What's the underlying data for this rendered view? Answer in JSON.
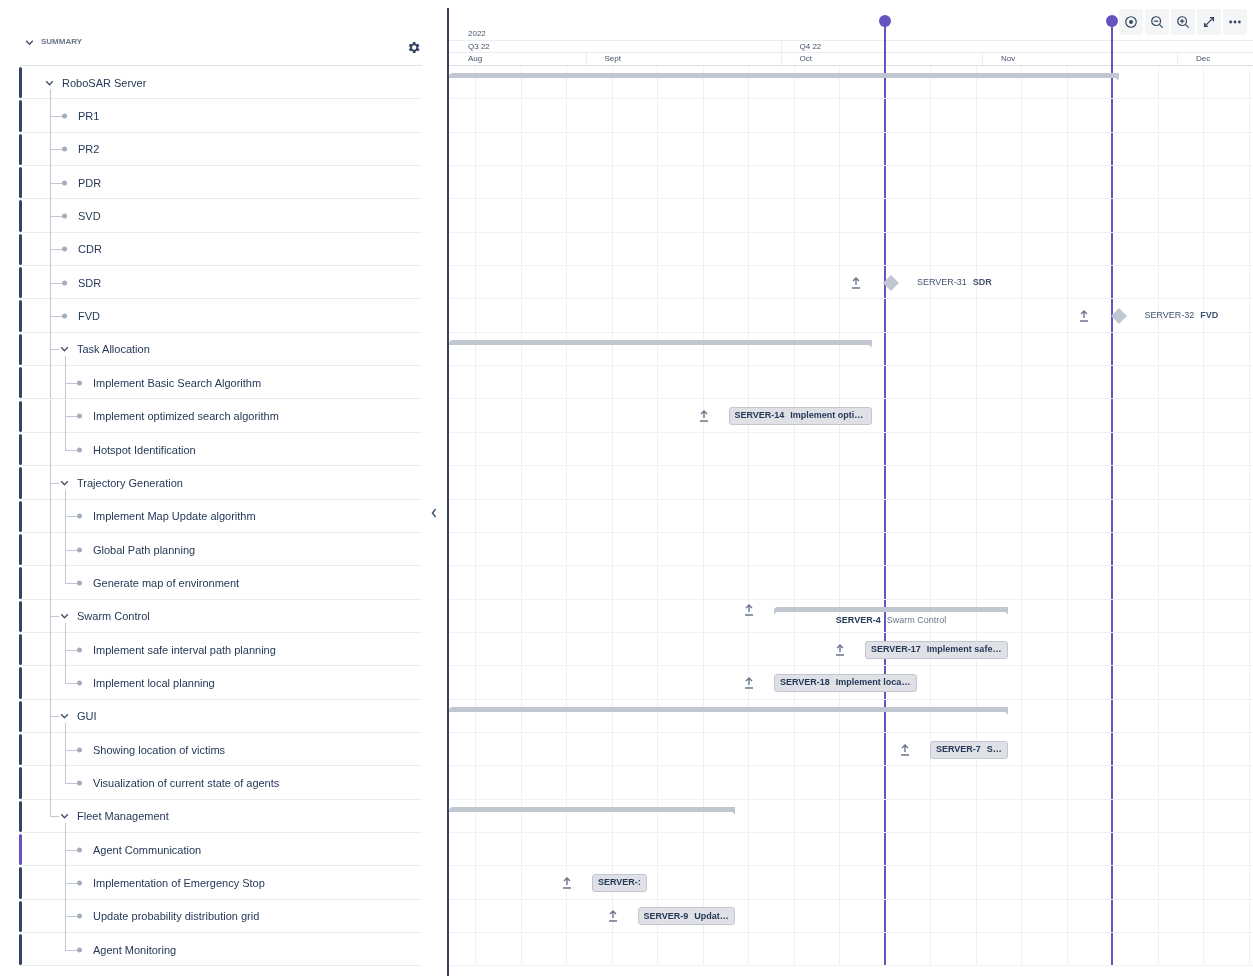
{
  "sidebar": {
    "title": "SUMMARY",
    "expanded": true
  },
  "timeline": {
    "year": "2022",
    "quarters": [
      {
        "label": "Q3 22"
      },
      {
        "label": "Q4 22"
      }
    ],
    "months": [
      {
        "label": "Aug"
      },
      {
        "label": "Sept"
      },
      {
        "label": "Oct"
      },
      {
        "label": "Nov"
      },
      {
        "label": "Dec"
      }
    ]
  },
  "tree": [
    {
      "label": "RoboSAR Server",
      "expanded": true,
      "color": "#344563",
      "bar": {
        "kind": "summary"
      },
      "children": [
        {
          "label": "PR1",
          "color": "#344563"
        },
        {
          "label": "PR2",
          "color": "#344563"
        },
        {
          "label": "PDR",
          "color": "#344563"
        },
        {
          "label": "SVD",
          "color": "#344563"
        },
        {
          "label": "CDR",
          "color": "#344563"
        },
        {
          "label": "SDR",
          "color": "#344563",
          "bar": {
            "kind": "milestone",
            "key": "SERVER-31",
            "title": "SDR"
          }
        },
        {
          "label": "FVD",
          "color": "#344563",
          "bar": {
            "kind": "milestone",
            "key": "SERVER-32",
            "title": "FVD"
          }
        },
        {
          "label": "Task Allocation",
          "expanded": true,
          "color": "#344563",
          "bar": {
            "kind": "summary"
          },
          "children": [
            {
              "label": "Implement Basic Search Algorithm",
              "color": "#344563"
            },
            {
              "label": "Implement optimized search algorithm",
              "color": "#344563",
              "bar": {
                "kind": "task",
                "key": "SERVER-14",
                "title": "Implement opti…"
              }
            },
            {
              "label": "Hotspot Identification",
              "color": "#344563"
            }
          ]
        },
        {
          "label": "Trajectory Generation",
          "expanded": true,
          "color": "#344563",
          "children": [
            {
              "label": "Implement Map Update algorithm",
              "color": "#344563"
            },
            {
              "label": "Global Path planning",
              "color": "#344563"
            },
            {
              "label": "Generate map of environment",
              "color": "#344563"
            }
          ]
        },
        {
          "label": "Swarm Control",
          "expanded": true,
          "color": "#344563",
          "bar": {
            "kind": "summary",
            "key": "SERVER-4",
            "title": "Swarm Control"
          },
          "children": [
            {
              "label": "Implement safe interval path planning",
              "color": "#344563",
              "bar": {
                "kind": "task",
                "key": "SERVER-17",
                "title": "Implement safe…"
              }
            },
            {
              "label": "Implement local planning",
              "color": "#344563",
              "bar": {
                "kind": "task",
                "key": "SERVER-18",
                "title": "Implement loca…"
              }
            }
          ]
        },
        {
          "label": "GUI",
          "expanded": true,
          "color": "#344563",
          "bar": {
            "kind": "summary"
          },
          "children": [
            {
              "label": "Showing location of victims",
              "color": "#344563",
              "bar": {
                "kind": "task",
                "key": "SERVER-7",
                "title": "S…"
              }
            },
            {
              "label": "Visualization of current state of agents",
              "color": "#344563"
            }
          ]
        },
        {
          "label": "Fleet Management",
          "expanded": true,
          "color": "#344563",
          "bar": {
            "kind": "summary"
          },
          "children": [
            {
              "label": "Agent Communication",
              "color": "#6554c0"
            },
            {
              "label": "Implementation of Emergency Stop",
              "color": "#344563",
              "bar": {
                "kind": "task",
                "key": "SERVER-:"
              }
            },
            {
              "label": "Update probability distribution grid",
              "color": "#344563",
              "bar": {
                "kind": "task",
                "key": "SERVER-9",
                "title": "Updat…"
              }
            },
            {
              "label": "Agent Monitoring",
              "color": "#344563"
            }
          ]
        }
      ]
    }
  ]
}
